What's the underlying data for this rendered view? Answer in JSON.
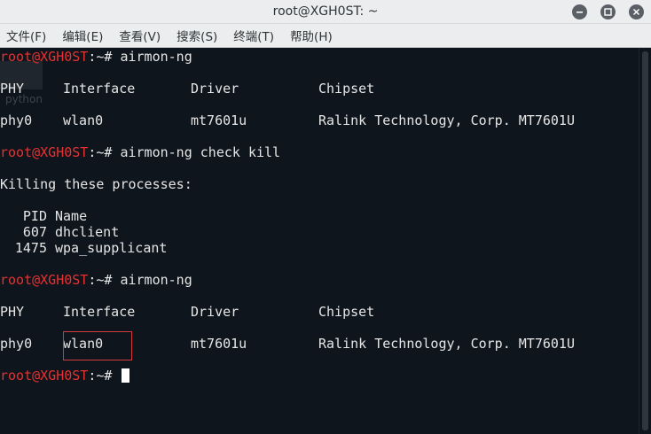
{
  "window": {
    "title": "root@XGH0ST: ~"
  },
  "menu": [
    "文件(F)",
    "编辑(E)",
    "查看(V)",
    "搜索(S)",
    "终端(T)",
    "帮助(H)"
  ],
  "background_label": "python",
  "prompt": {
    "user_host": "root@XGH0ST",
    "suffix": ":~# "
  },
  "commands": [
    "airmon-ng",
    "airmon-ng check kill",
    "airmon-ng"
  ],
  "table_headers": [
    "PHY",
    "Interface",
    "Driver",
    "Chipset"
  ],
  "table_row": [
    "phy0",
    "wlan0",
    "mt7601u",
    "Ralink Technology, Corp. MT7601U"
  ],
  "kill_output": {
    "message": "Killing these processes:",
    "header": [
      "PID",
      "Name"
    ],
    "processes": [
      {
        "pid": "607",
        "name": "dhclient"
      },
      {
        "pid": "1475",
        "name": "wpa_supplicant"
      }
    ]
  },
  "colors": {
    "prompt_red": "#e63232",
    "terminal_bg": "#0f151c",
    "highlight_box": "#d33b3b"
  }
}
